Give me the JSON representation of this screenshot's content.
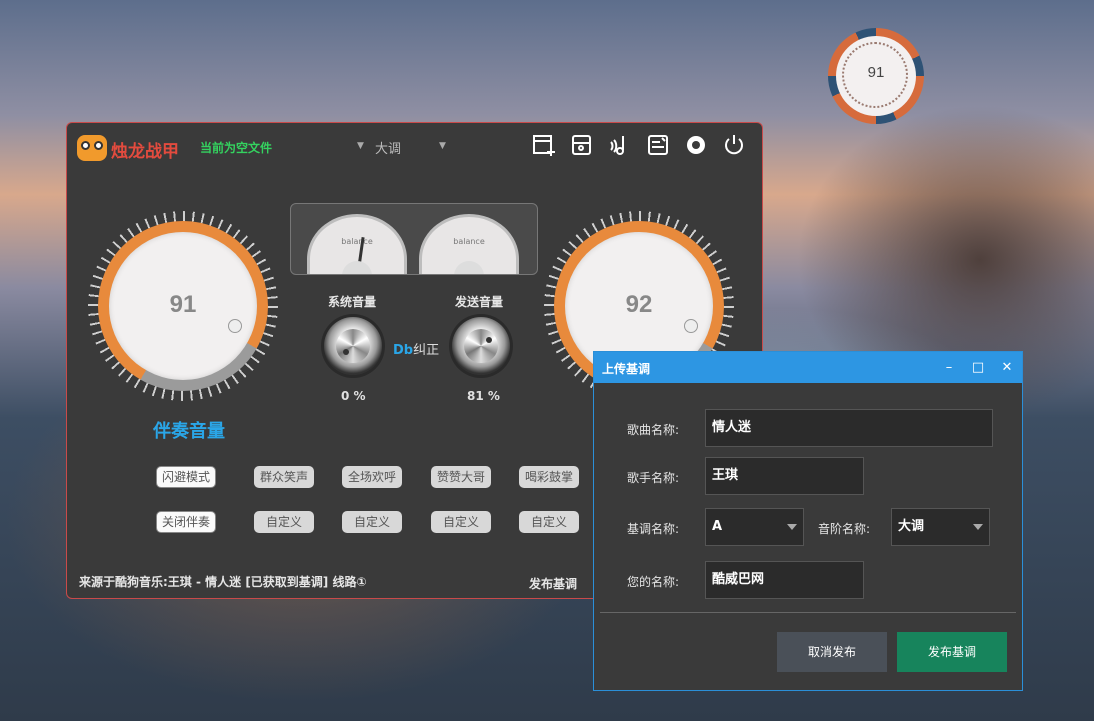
{
  "float_ball": {
    "value": "91"
  },
  "main": {
    "brand": "烛龙战甲",
    "file_status": "当前为空文件",
    "key_select": {
      "value": "大调"
    },
    "toolbar": [
      "new-project-icon",
      "save-icon",
      "music-note-icon",
      "edit-list-icon",
      "settings-icon",
      "power-icon"
    ],
    "left_knob": {
      "value": "91",
      "level": 0.75
    },
    "right_knob": {
      "value": "92"
    },
    "accompaniment_label": "伴奏音量",
    "meters": {
      "left_label": "balance",
      "right_label": "balance"
    },
    "system_volume": {
      "label": "系统音量",
      "percent": "0 %"
    },
    "send_volume": {
      "label": "发送音量",
      "percent": "81 %"
    },
    "db_correct": {
      "db": "Db",
      "text": "纠正"
    },
    "effects_row1": [
      "闪避模式",
      "群众笑声",
      "全场欢呼",
      "赞赞大哥",
      "喝彩鼓掌"
    ],
    "effects_row2": [
      "关闭伴奏",
      "自定义",
      "自定义",
      "自定义",
      "自定义"
    ],
    "source": "来源于酷狗音乐:王琪 - 情人迷 [已获取到基调] 线路①",
    "publish_link": "发布基调"
  },
  "dialog": {
    "title": "上传基调",
    "window_controls": {
      "minimize": "–",
      "maximize": "□",
      "close": "✕"
    },
    "song_label": "歌曲名称:",
    "song_value": "情人迷",
    "singer_label": "歌手名称:",
    "singer_value": "王琪",
    "key_label": "基调名称:",
    "key_value": "A",
    "scale_label": "音阶名称:",
    "scale_value": "大调",
    "your_name_label": "您的名称:",
    "your_name_value": "酷威巴网",
    "cancel_button": "取消发布",
    "publish_button": "发布基调",
    "colors": {
      "accent": "#2d96e3",
      "publish": "#17845c",
      "cancel": "#4a5058"
    }
  }
}
